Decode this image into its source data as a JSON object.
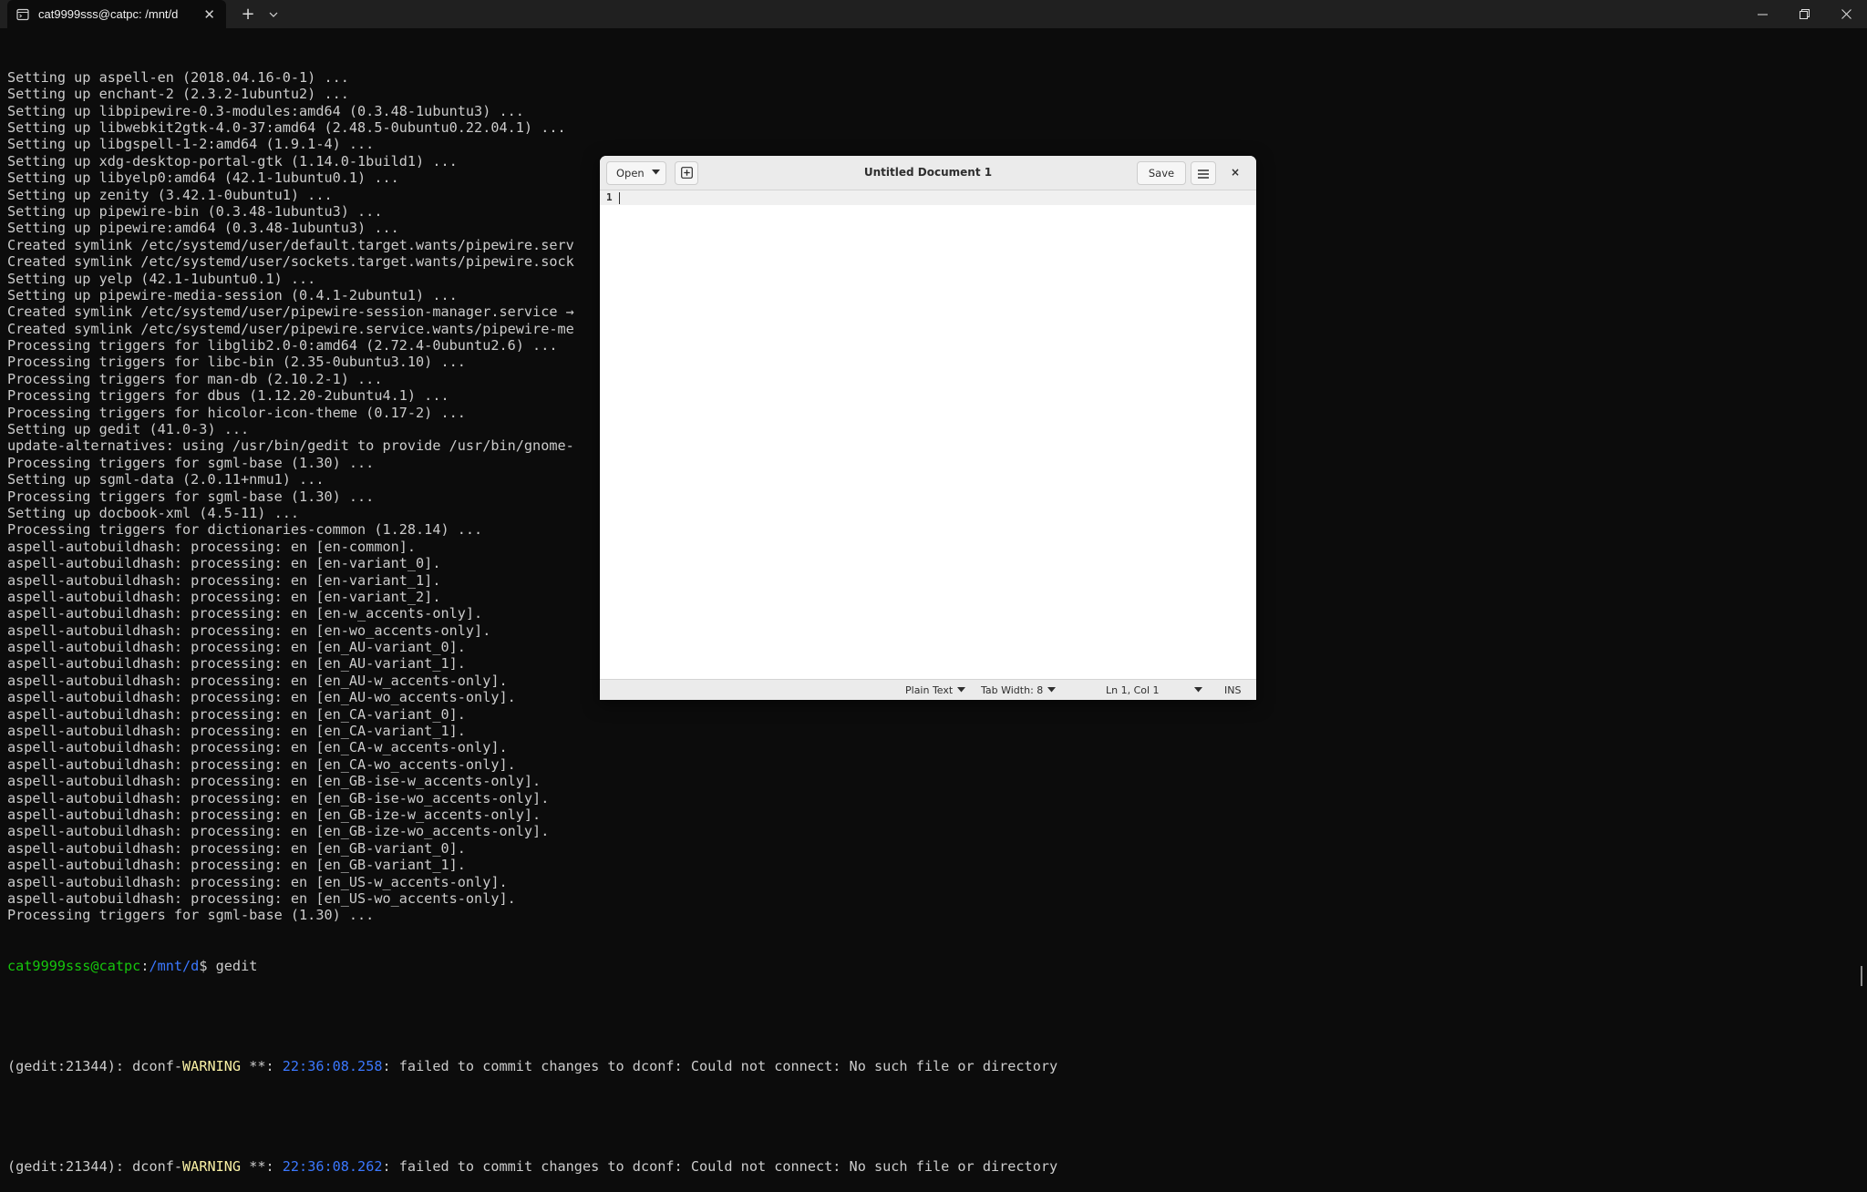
{
  "tab": {
    "title": "cat9999sss@catpc: /mnt/d",
    "close": "✕",
    "new_tab": "+",
    "dropdown": "⌵"
  },
  "window_controls": {
    "minimize": "—",
    "maximize": "❐",
    "close": "✕"
  },
  "terminal": {
    "lines": [
      "Setting up aspell-en (2018.04.16-0-1) ...",
      "Setting up enchant-2 (2.3.2-1ubuntu2) ...",
      "Setting up libpipewire-0.3-modules:amd64 (0.3.48-1ubuntu3) ...",
      "Setting up libwebkit2gtk-4.0-37:amd64 (2.48.5-0ubuntu0.22.04.1) ...",
      "Setting up libgspell-1-2:amd64 (1.9.1-4) ...",
      "Setting up xdg-desktop-portal-gtk (1.14.0-1build1) ...",
      "Setting up libyelp0:amd64 (42.1-1ubuntu0.1) ...",
      "Setting up zenity (3.42.1-0ubuntu1) ...",
      "Setting up pipewire-bin (0.3.48-1ubuntu3) ...",
      "Setting up pipewire:amd64 (0.3.48-1ubuntu3) ...",
      "Created symlink /etc/systemd/user/default.target.wants/pipewire.serv",
      "Created symlink /etc/systemd/user/sockets.target.wants/pipewire.sock",
      "Setting up yelp (42.1-1ubuntu0.1) ...",
      "Setting up pipewire-media-session (0.4.1-2ubuntu1) ...",
      "Created symlink /etc/systemd/user/pipewire-session-manager.service →",
      "Created symlink /etc/systemd/user/pipewire.service.wants/pipewire-me",
      "Processing triggers for libglib2.0-0:amd64 (2.72.4-0ubuntu2.6) ...",
      "Processing triggers for libc-bin (2.35-0ubuntu3.10) ...",
      "Processing triggers for man-db (2.10.2-1) ...",
      "Processing triggers for dbus (1.12.20-2ubuntu4.1) ...",
      "Processing triggers for hicolor-icon-theme (0.17-2) ...",
      "Setting up gedit (41.0-3) ...",
      "update-alternatives: using /usr/bin/gedit to provide /usr/bin/gnome-",
      "Processing triggers for sgml-base (1.30) ...",
      "Setting up sgml-data (2.0.11+nmu1) ...",
      "Processing triggers for sgml-base (1.30) ...",
      "Setting up docbook-xml (4.5-11) ...",
      "Processing triggers for dictionaries-common (1.28.14) ...",
      "aspell-autobuildhash: processing: en [en-common].",
      "aspell-autobuildhash: processing: en [en-variant_0].",
      "aspell-autobuildhash: processing: en [en-variant_1].",
      "aspell-autobuildhash: processing: en [en-variant_2].",
      "aspell-autobuildhash: processing: en [en-w_accents-only].",
      "aspell-autobuildhash: processing: en [en-wo_accents-only].",
      "aspell-autobuildhash: processing: en [en_AU-variant_0].",
      "aspell-autobuildhash: processing: en [en_AU-variant_1].",
      "aspell-autobuildhash: processing: en [en_AU-w_accents-only].",
      "aspell-autobuildhash: processing: en [en_AU-wo_accents-only].",
      "aspell-autobuildhash: processing: en [en_CA-variant_0].",
      "aspell-autobuildhash: processing: en [en_CA-variant_1].",
      "aspell-autobuildhash: processing: en [en_CA-w_accents-only].",
      "aspell-autobuildhash: processing: en [en_CA-wo_accents-only].",
      "aspell-autobuildhash: processing: en [en_GB-ise-w_accents-only].",
      "aspell-autobuildhash: processing: en [en_GB-ise-wo_accents-only].",
      "aspell-autobuildhash: processing: en [en_GB-ize-w_accents-only].",
      "aspell-autobuildhash: processing: en [en_GB-ize-wo_accents-only].",
      "aspell-autobuildhash: processing: en [en_GB-variant_0].",
      "aspell-autobuildhash: processing: en [en_GB-variant_1].",
      "aspell-autobuildhash: processing: en [en_US-w_accents-only].",
      "aspell-autobuildhash: processing: en [en_US-wo_accents-only].",
      "Processing triggers for sgml-base (1.30) ..."
    ],
    "prompt": {
      "user": "cat9999sss@catpc",
      "sep": ":",
      "path": "/mnt/d",
      "symbol": "$ ",
      "command": "gedit"
    },
    "warnings": [
      {
        "prefix": "(gedit:21344): dconf-",
        "level": "WARNING",
        "mid": " **: ",
        "time": "22:36:08.258",
        "message": ": failed to commit changes to dconf: Could not connect: No such file or directory"
      },
      {
        "prefix": "(gedit:21344): dconf-",
        "level": "WARNING",
        "mid": " **: ",
        "time": "22:36:08.262",
        "message": ": failed to commit changes to dconf: Could not connect: No such file or directory"
      }
    ]
  },
  "gedit": {
    "open_label": "Open",
    "title": "Untitled Document 1",
    "save_label": "Save",
    "close": "×",
    "line_number": "1",
    "status": {
      "language": "Plain Text",
      "tab_width": "Tab Width: 8",
      "position": "Ln 1, Col 1",
      "mode": "INS"
    }
  }
}
